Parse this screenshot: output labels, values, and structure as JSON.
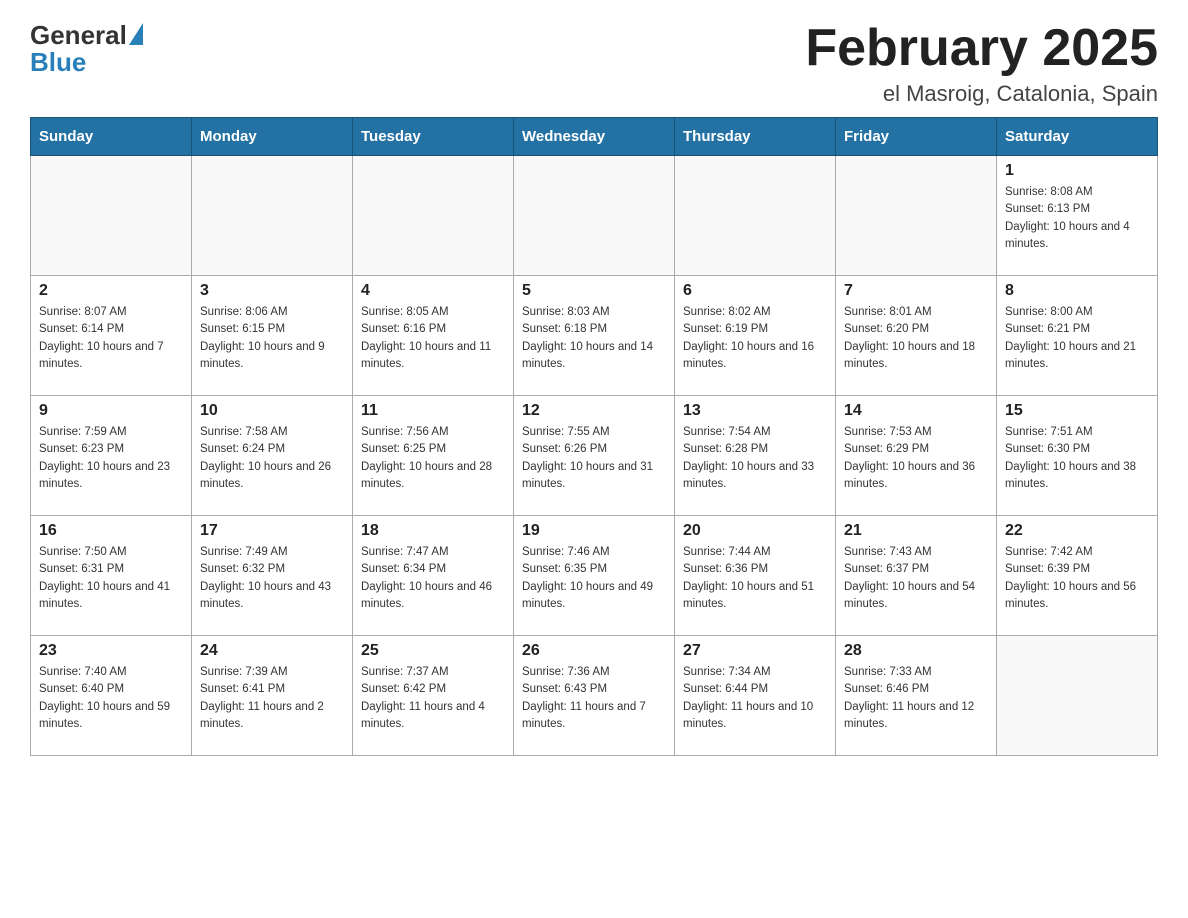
{
  "header": {
    "logo_general": "General",
    "logo_blue": "Blue",
    "title": "February 2025",
    "subtitle": "el Masroig, Catalonia, Spain"
  },
  "days_of_week": [
    "Sunday",
    "Monday",
    "Tuesday",
    "Wednesday",
    "Thursday",
    "Friday",
    "Saturday"
  ],
  "weeks": [
    [
      {
        "day": "",
        "info": ""
      },
      {
        "day": "",
        "info": ""
      },
      {
        "day": "",
        "info": ""
      },
      {
        "day": "",
        "info": ""
      },
      {
        "day": "",
        "info": ""
      },
      {
        "day": "",
        "info": ""
      },
      {
        "day": "1",
        "info": "Sunrise: 8:08 AM\nSunset: 6:13 PM\nDaylight: 10 hours and 4 minutes."
      }
    ],
    [
      {
        "day": "2",
        "info": "Sunrise: 8:07 AM\nSunset: 6:14 PM\nDaylight: 10 hours and 7 minutes."
      },
      {
        "day": "3",
        "info": "Sunrise: 8:06 AM\nSunset: 6:15 PM\nDaylight: 10 hours and 9 minutes."
      },
      {
        "day": "4",
        "info": "Sunrise: 8:05 AM\nSunset: 6:16 PM\nDaylight: 10 hours and 11 minutes."
      },
      {
        "day": "5",
        "info": "Sunrise: 8:03 AM\nSunset: 6:18 PM\nDaylight: 10 hours and 14 minutes."
      },
      {
        "day": "6",
        "info": "Sunrise: 8:02 AM\nSunset: 6:19 PM\nDaylight: 10 hours and 16 minutes."
      },
      {
        "day": "7",
        "info": "Sunrise: 8:01 AM\nSunset: 6:20 PM\nDaylight: 10 hours and 18 minutes."
      },
      {
        "day": "8",
        "info": "Sunrise: 8:00 AM\nSunset: 6:21 PM\nDaylight: 10 hours and 21 minutes."
      }
    ],
    [
      {
        "day": "9",
        "info": "Sunrise: 7:59 AM\nSunset: 6:23 PM\nDaylight: 10 hours and 23 minutes."
      },
      {
        "day": "10",
        "info": "Sunrise: 7:58 AM\nSunset: 6:24 PM\nDaylight: 10 hours and 26 minutes."
      },
      {
        "day": "11",
        "info": "Sunrise: 7:56 AM\nSunset: 6:25 PM\nDaylight: 10 hours and 28 minutes."
      },
      {
        "day": "12",
        "info": "Sunrise: 7:55 AM\nSunset: 6:26 PM\nDaylight: 10 hours and 31 minutes."
      },
      {
        "day": "13",
        "info": "Sunrise: 7:54 AM\nSunset: 6:28 PM\nDaylight: 10 hours and 33 minutes."
      },
      {
        "day": "14",
        "info": "Sunrise: 7:53 AM\nSunset: 6:29 PM\nDaylight: 10 hours and 36 minutes."
      },
      {
        "day": "15",
        "info": "Sunrise: 7:51 AM\nSunset: 6:30 PM\nDaylight: 10 hours and 38 minutes."
      }
    ],
    [
      {
        "day": "16",
        "info": "Sunrise: 7:50 AM\nSunset: 6:31 PM\nDaylight: 10 hours and 41 minutes."
      },
      {
        "day": "17",
        "info": "Sunrise: 7:49 AM\nSunset: 6:32 PM\nDaylight: 10 hours and 43 minutes."
      },
      {
        "day": "18",
        "info": "Sunrise: 7:47 AM\nSunset: 6:34 PM\nDaylight: 10 hours and 46 minutes."
      },
      {
        "day": "19",
        "info": "Sunrise: 7:46 AM\nSunset: 6:35 PM\nDaylight: 10 hours and 49 minutes."
      },
      {
        "day": "20",
        "info": "Sunrise: 7:44 AM\nSunset: 6:36 PM\nDaylight: 10 hours and 51 minutes."
      },
      {
        "day": "21",
        "info": "Sunrise: 7:43 AM\nSunset: 6:37 PM\nDaylight: 10 hours and 54 minutes."
      },
      {
        "day": "22",
        "info": "Sunrise: 7:42 AM\nSunset: 6:39 PM\nDaylight: 10 hours and 56 minutes."
      }
    ],
    [
      {
        "day": "23",
        "info": "Sunrise: 7:40 AM\nSunset: 6:40 PM\nDaylight: 10 hours and 59 minutes."
      },
      {
        "day": "24",
        "info": "Sunrise: 7:39 AM\nSunset: 6:41 PM\nDaylight: 11 hours and 2 minutes."
      },
      {
        "day": "25",
        "info": "Sunrise: 7:37 AM\nSunset: 6:42 PM\nDaylight: 11 hours and 4 minutes."
      },
      {
        "day": "26",
        "info": "Sunrise: 7:36 AM\nSunset: 6:43 PM\nDaylight: 11 hours and 7 minutes."
      },
      {
        "day": "27",
        "info": "Sunrise: 7:34 AM\nSunset: 6:44 PM\nDaylight: 11 hours and 10 minutes."
      },
      {
        "day": "28",
        "info": "Sunrise: 7:33 AM\nSunset: 6:46 PM\nDaylight: 11 hours and 12 minutes."
      },
      {
        "day": "",
        "info": ""
      }
    ]
  ]
}
